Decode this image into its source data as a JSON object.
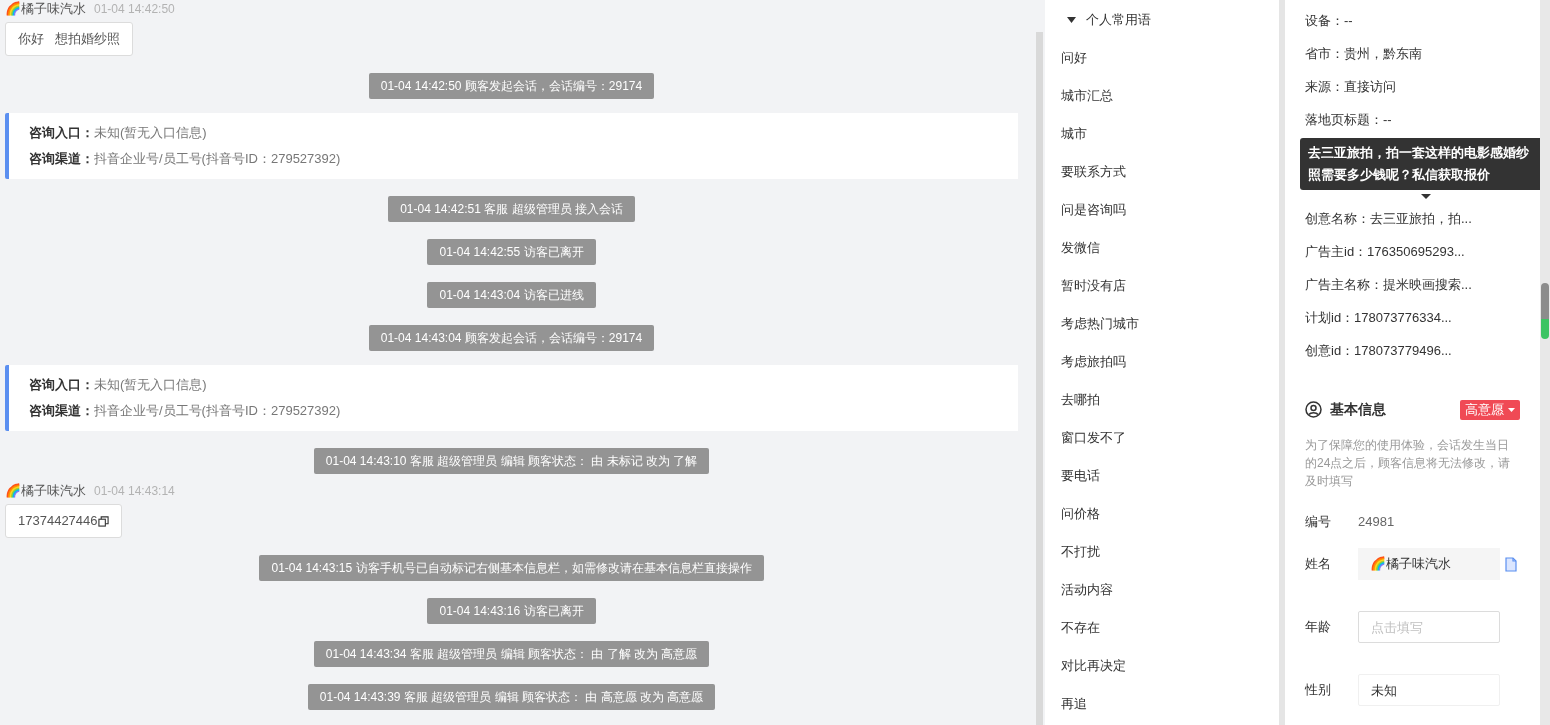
{
  "chat": [
    {
      "kind": "visitor",
      "name": "🌈橘子味汽水",
      "time": "01-04 14:42:50",
      "text": "你好   想拍婚纱照",
      "copyable": false
    },
    {
      "kind": "system",
      "text": "01-04 14:42:50 顾客发起会话，会话编号：29174"
    },
    {
      "kind": "entry",
      "rows": [
        {
          "label": "咨询入口：",
          "value": "未知(暂无入口信息)"
        },
        {
          "label": "咨询渠道：",
          "value": "抖音企业号/员工号(抖音号ID：279527392)"
        }
      ]
    },
    {
      "kind": "system",
      "text": "01-04 14:42:51 客服 超级管理员 接入会话"
    },
    {
      "kind": "system",
      "text": "01-04 14:42:55 访客已离开"
    },
    {
      "kind": "system",
      "text": "01-04 14:43:04 访客已进线"
    },
    {
      "kind": "system",
      "text": "01-04 14:43:04 顾客发起会话，会话编号：29174"
    },
    {
      "kind": "entry",
      "rows": [
        {
          "label": "咨询入口：",
          "value": "未知(暂无入口信息)"
        },
        {
          "label": "咨询渠道：",
          "value": "抖音企业号/员工号(抖音号ID：279527392)"
        }
      ]
    },
    {
      "kind": "system",
      "text": "01-04 14:43:10 客服 超级管理员 编辑 顾客状态： 由 未标记 改为 了解"
    },
    {
      "kind": "visitor",
      "name": "🌈橘子味汽水",
      "time": "01-04 14:43:14",
      "text": "17374427446",
      "copyable": true
    },
    {
      "kind": "system",
      "text": "01-04 14:43:15 访客手机号已自动标记右侧基本信息栏，如需修改请在基本信息栏直接操作"
    },
    {
      "kind": "system",
      "text": "01-04 14:43:16 访客已离开"
    },
    {
      "kind": "system",
      "text": "01-04 14:43:34 客服 超级管理员 编辑 顾客状态： 由 了解 改为 高意愿"
    },
    {
      "kind": "system",
      "text": "01-04 14:43:39 客服 超级管理员 编辑 顾客状态： 由 高意愿 改为 高意愿"
    }
  ],
  "phrases": {
    "title": "个人常用语",
    "expanded": true,
    "items": [
      "问好",
      "城市汇总",
      "城市",
      "要联系方式",
      "问是咨询吗",
      "发微信",
      "暂时没有店",
      "考虑热门城市",
      "考虑旅拍吗",
      "去哪拍",
      "窗口发不了",
      "要电话",
      "问价格",
      "不打扰",
      "活动内容",
      "不存在",
      "对比再决定",
      "再追"
    ]
  },
  "source_info": {
    "rows_before": [
      "设备：--",
      "省市：贵州，黔东南",
      "来源：直接访问",
      "落地页标题：--"
    ],
    "tooltip": "去三亚旅拍，拍一套这样的电影感婚纱照需要多少钱呢？私信获取报价",
    "rows_after": [
      "创意名称：去三亚旅拍，拍...",
      "广告主id：176350695293...",
      "广告主名称：提米映画搜索...",
      "计划id：178073776334...",
      "创意id：178073779496..."
    ]
  },
  "basic_info": {
    "title": "基本信息",
    "intent": "高意愿",
    "note": "为了保障您的使用体验，会话发生当日的24点之后，顾客信息将无法修改，请及时填写",
    "fields": [
      {
        "kind": "static",
        "label": "编号",
        "value": "24981"
      },
      {
        "kind": "filled",
        "label": "姓名",
        "value": "🌈橘子味汽水"
      },
      {
        "kind": "input",
        "label": "年龄",
        "placeholder": "点击填写"
      },
      {
        "kind": "select",
        "label": "性别",
        "value": "未知"
      }
    ]
  }
}
